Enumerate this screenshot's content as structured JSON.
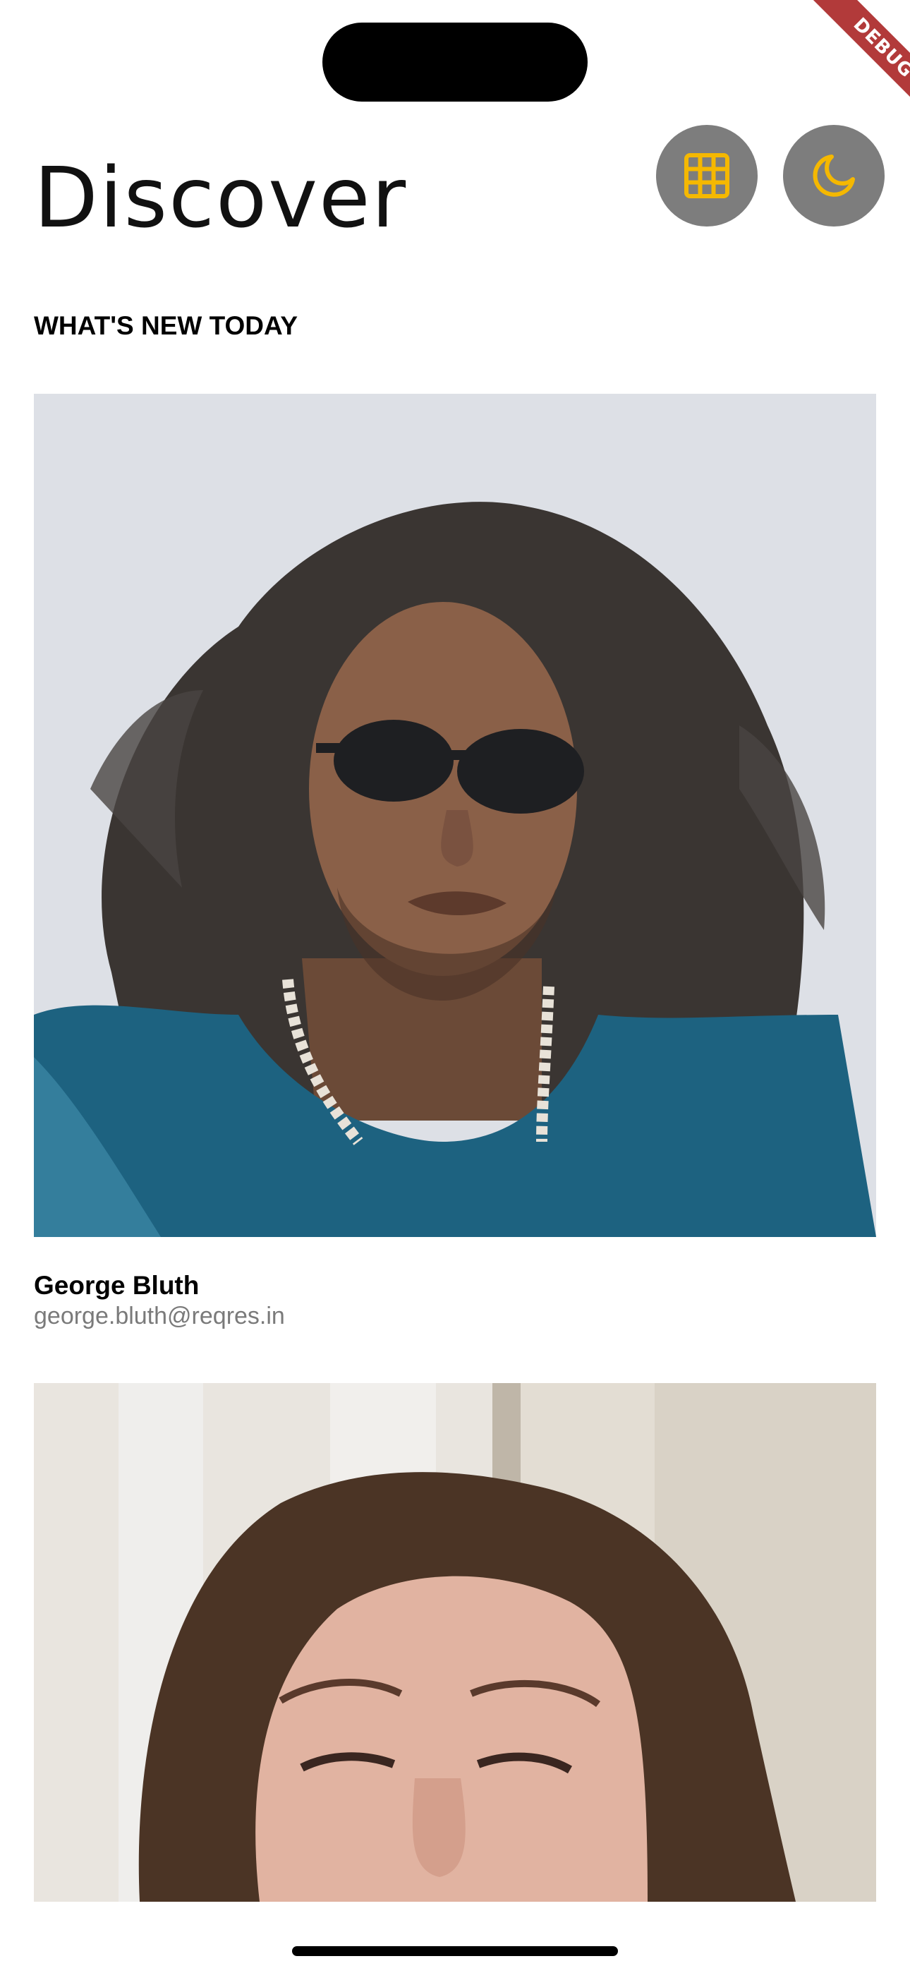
{
  "debug_banner": {
    "label": "DEBUG"
  },
  "header": {
    "title": "Discover",
    "grid_button_icon": "grid-icon",
    "theme_button_icon": "moon-icon",
    "icon_color": "#f5b800",
    "button_color": "#7d7d7d"
  },
  "section": {
    "heading": "WHAT'S NEW TODAY"
  },
  "cards": [
    {
      "name": "George Bluth",
      "email": "george.bluth@reqres.in",
      "photo": "photo of man with long curly hair, sunglasses and teal shirt"
    },
    {
      "photo": "photo of woman with dark wavy hair smiling"
    }
  ]
}
